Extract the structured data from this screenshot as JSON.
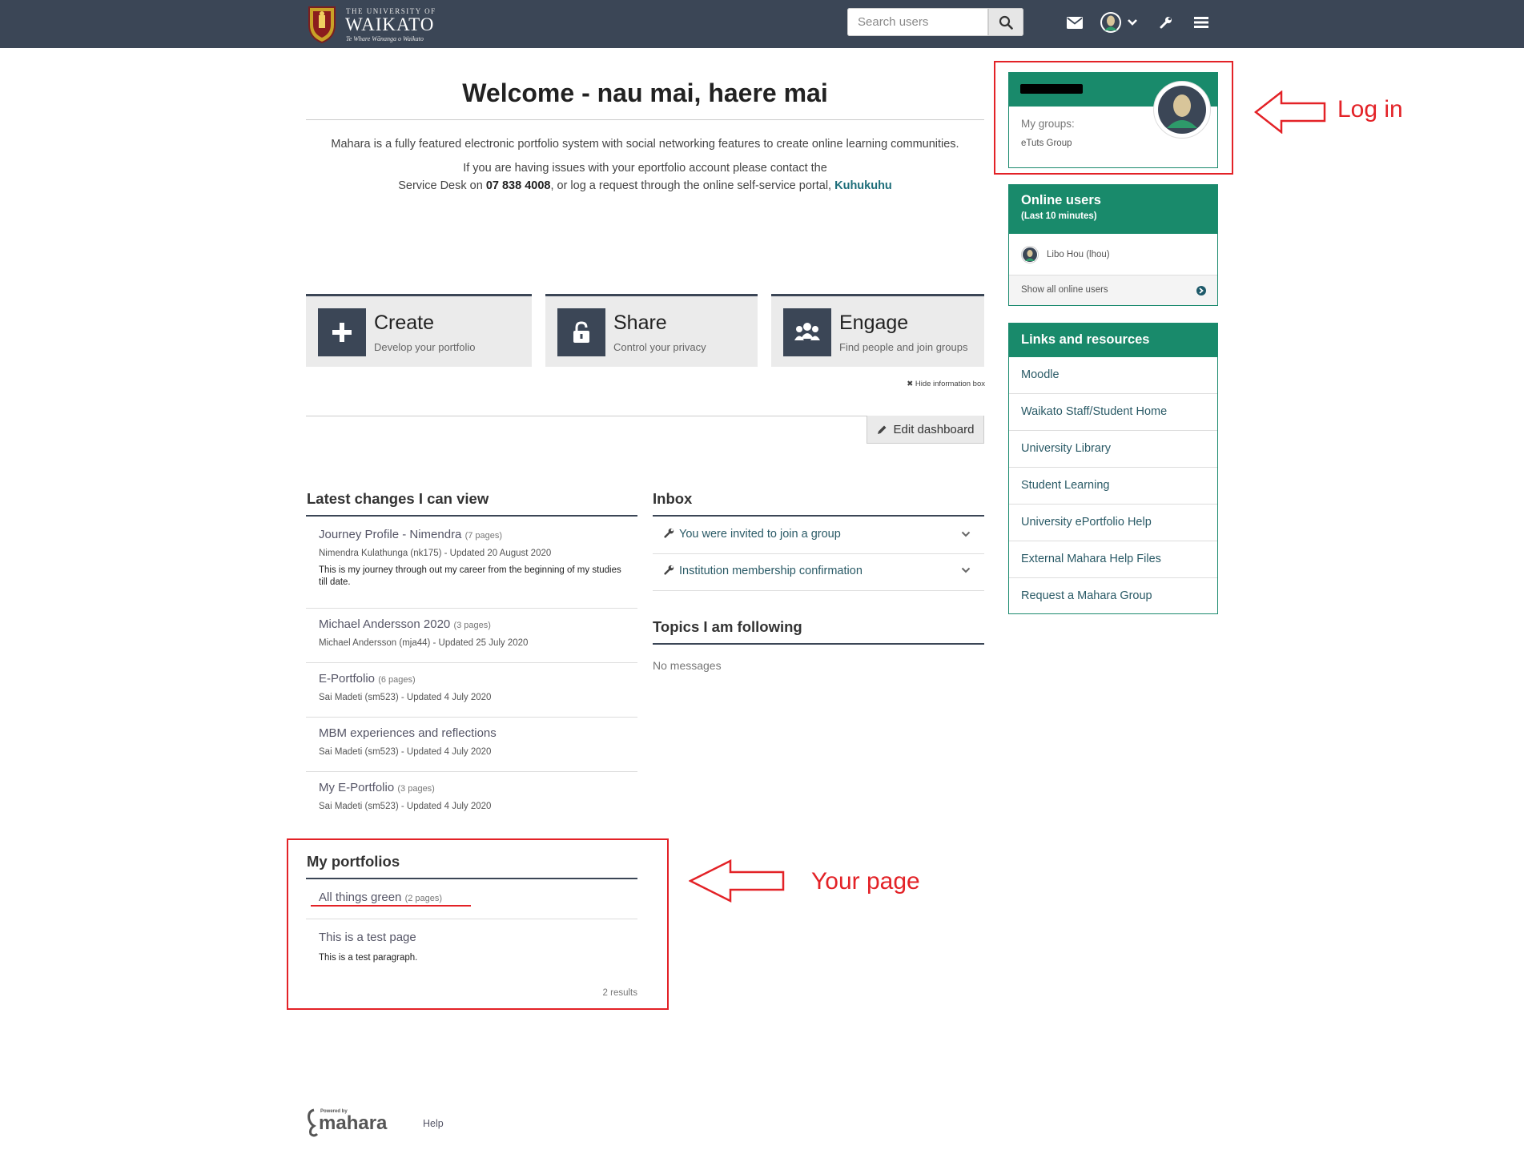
{
  "header": {
    "logo": {
      "line1": "THE UNIVERSITY OF",
      "line2": "WAIKATO",
      "line3": "Te Whare Wānanga o Waikato"
    },
    "search_placeholder": "Search users",
    "icons": [
      "search-icon",
      "mail-icon",
      "user-avatar-icon",
      "chevron-down-icon",
      "wrench-icon",
      "menu-icon"
    ]
  },
  "welcome": {
    "title": "Welcome - nau mai, haere mai",
    "intro": "Mahara is a fully featured electronic portfolio system with social networking features to create online learning communities.",
    "issues_line1": "If you are having issues with your eportfolio account please contact the",
    "issues_pre": "Service Desk on ",
    "phone": "07 838 4008",
    "issues_mid": ", or log a request through the online self-service portal, ",
    "portal": "Kuhukuhu"
  },
  "features": [
    {
      "title": "Create",
      "sub": "Develop your portfolio",
      "icon": "plus-icon"
    },
    {
      "title": "Share",
      "sub": "Control your privacy",
      "icon": "unlock-icon"
    },
    {
      "title": "Engage",
      "sub": "Find people and join groups",
      "icon": "users-icon"
    }
  ],
  "hide_info": "Hide information box",
  "edit_dashboard": "Edit dashboard",
  "latest": {
    "title": "Latest changes I can view",
    "items": [
      {
        "title": "Journey Profile - Nimendra",
        "pages": "(7 pages)",
        "meta": "Nimendra Kulathunga (nk175) - Updated 20 August 2020",
        "desc": "This is my journey through out my career from the beginning of my studies till date."
      },
      {
        "title": "Michael Andersson 2020",
        "pages": "(3 pages)",
        "meta": "Michael Andersson (mja44) - Updated 25 July 2020",
        "desc": ""
      },
      {
        "title": "E-Portfolio",
        "pages": "(6 pages)",
        "meta": "Sai Madeti (sm523) - Updated 4 July 2020",
        "desc": ""
      },
      {
        "title": "MBM experiences and reflections",
        "pages": "",
        "meta": "Sai Madeti (sm523) - Updated 4 July 2020",
        "desc": ""
      },
      {
        "title": "My E-Portfolio",
        "pages": "(3 pages)",
        "meta": "Sai Madeti (sm523) - Updated 4 July 2020",
        "desc": ""
      }
    ]
  },
  "inbox": {
    "title": "Inbox",
    "items": [
      "You were invited to join a group",
      "Institution membership confirmation"
    ]
  },
  "topics": {
    "title": "Topics I am following",
    "empty": "No messages"
  },
  "portfolios": {
    "title": "My portfolios",
    "items": [
      {
        "title": "All things green",
        "pages": "(2 pages)",
        "desc": ""
      },
      {
        "title": "This is a test page",
        "pages": "",
        "desc": "This is a test paragraph."
      }
    ],
    "results": "2 results"
  },
  "sidebar": {
    "profile": {
      "my_groups": "My groups:",
      "group": "eTuts Group"
    },
    "online": {
      "title": "Online users",
      "subtitle": "(Last 10 minutes)",
      "user": "Libo Hou (lhou)",
      "show_all": "Show all online users"
    },
    "links": {
      "title": "Links and resources",
      "items": [
        "Moodle",
        "Waikato Staff/Student Home",
        "University Library",
        "Student Learning",
        "University ePortfolio Help",
        "External Mahara Help Files",
        "Request a Mahara Group"
      ]
    }
  },
  "annotations": {
    "login": "Log in",
    "your_page": "Your page"
  },
  "footer": {
    "powered": "Powered by",
    "brand": "mahara",
    "help": "Help"
  },
  "colors": {
    "topbar": "#3b4656",
    "accent_green": "#198a6b",
    "annotation_red": "#e32227"
  }
}
